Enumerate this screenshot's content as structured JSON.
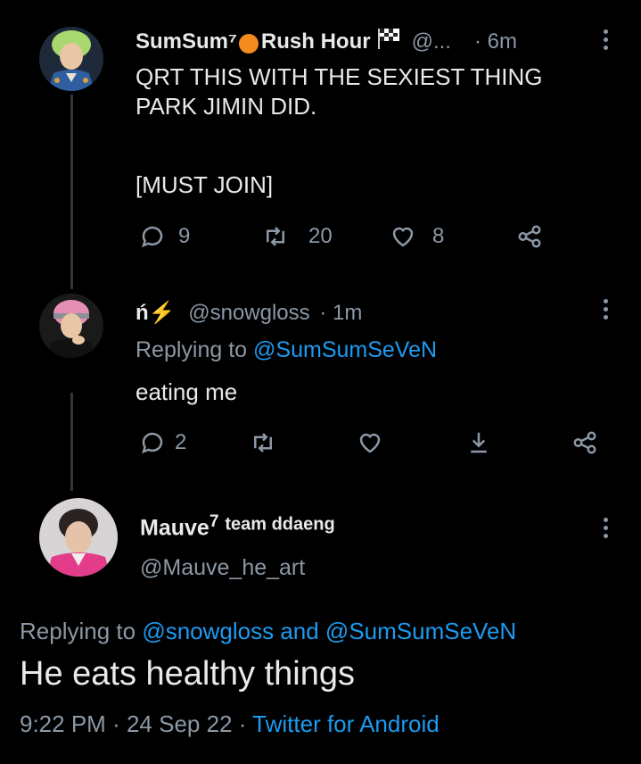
{
  "tweet1": {
    "name": "SumSum⁷",
    "name_part2": "Rush Hour",
    "handle": "@...",
    "time": "· 6m",
    "text_line1": "QRT THIS WITH THE SEXIEST THING",
    "text_line2": "PARK JIMIN DID.",
    "text_line3": "[MUST JOIN]",
    "replies": "9",
    "retweets": "20",
    "likes": "8"
  },
  "tweet2": {
    "name": "ń⚡",
    "handle": "@snowgloss",
    "time": "· 1m",
    "replying_prefix": "Replying to ",
    "replying_to": "@SumSumSeVeN",
    "text": "eating me",
    "replies": "2"
  },
  "tweet3": {
    "name": "Mauve⁷ team ddaeng",
    "name_main": "Mauve",
    "name_sup": "7",
    "name_suffix": "team ddaeng",
    "handle": "@Mauve_he_art",
    "replying_prefix": "Replying to ",
    "replying_to": "@snowgloss and @SumSumSeVeN",
    "text": "He eats healthy things",
    "time": "9:22 PM",
    "date": "24 Sep 22",
    "source": "Twitter for Android"
  },
  "icons": [
    "reply-icon",
    "retweet-icon",
    "like-icon",
    "share-icon",
    "download-icon",
    "more-icon"
  ],
  "colors": {
    "accent": "#1d9bf0",
    "muted": "#8b98a5",
    "text": "#e7e9ea",
    "background": "#000000"
  }
}
